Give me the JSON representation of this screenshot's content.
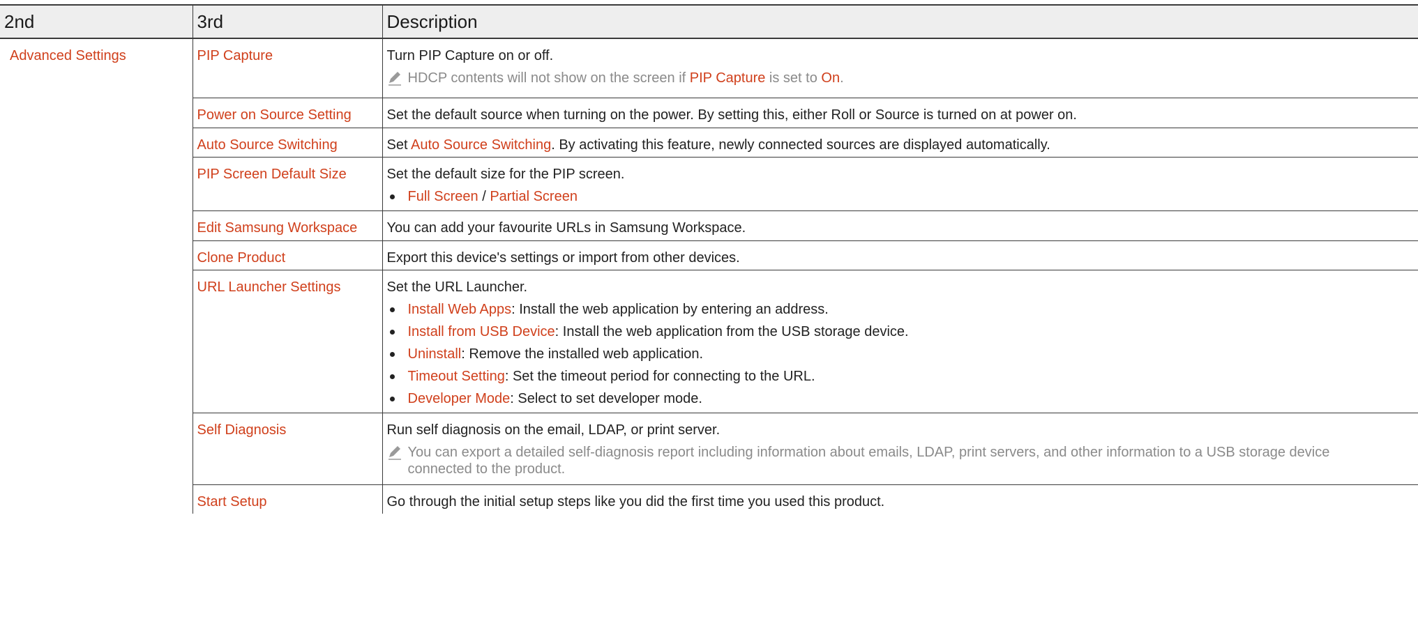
{
  "table": {
    "headers": [
      "2nd",
      "3rd",
      "Description"
    ],
    "second_level": "Advanced Settings",
    "rows": [
      {
        "name": "PIP Capture",
        "desc": "Turn PIP Capture on or off.",
        "note": {
          "a": "HDCP contents will not show on the screen if ",
          "b": "PIP Capture",
          "c": " is set to ",
          "d": "On",
          "e": "."
        }
      },
      {
        "name": "Power on Source Setting",
        "desc": "Set the default source when turning on the power. By setting this, either Roll or Source is turned on at power on."
      },
      {
        "name": "Auto Source Switching",
        "desc_a": "Set ",
        "desc_hl": "Auto Source Switching",
        "desc_b": ". By activating this feature, newly connected sources are displayed automatically."
      },
      {
        "name": "PIP Screen Default Size",
        "desc": "Set the default size for the PIP screen.",
        "bullet": {
          "a": "Full Screen",
          "sep": " / ",
          "b": "Partial Screen"
        }
      },
      {
        "name": "Edit Samsung Workspace",
        "desc": "You can add your favourite URLs in Samsung Workspace."
      },
      {
        "name": "Clone Product",
        "desc": "Export this device's settings or import from other devices."
      },
      {
        "name": "URL Launcher Settings",
        "desc": "Set the URL Launcher.",
        "bullets": [
          {
            "term": "Install Web Apps",
            "text": ": Install the web application by entering an address."
          },
          {
            "term": "Install from USB Device",
            "text": ": Install the web application from the USB storage device."
          },
          {
            "term": "Uninstall",
            "text": ": Remove the installed web application."
          },
          {
            "term": "Timeout Setting",
            "text": ": Set the timeout period for connecting to the URL."
          },
          {
            "term": "Developer Mode",
            "text": ": Select to set developer mode."
          }
        ]
      },
      {
        "name": "Self Diagnosis",
        "desc": "Run self diagnosis on the email, LDAP, or print server.",
        "note": "You can export a detailed self-diagnosis report including information about emails, LDAP, print servers, and other information to a USB storage device connected to the product."
      },
      {
        "name": "Start Setup",
        "desc": "Go through the initial setup steps like you did the first time you used this product."
      }
    ]
  },
  "colors": {
    "accent": "#d0401c",
    "text": "#222222",
    "note": "#8a8a8a",
    "header_bg": "#eeeeee",
    "rule": "#3a3a3a"
  },
  "icons": {
    "note": "pencil-icon",
    "bullet": "bullet-dot-icon"
  }
}
